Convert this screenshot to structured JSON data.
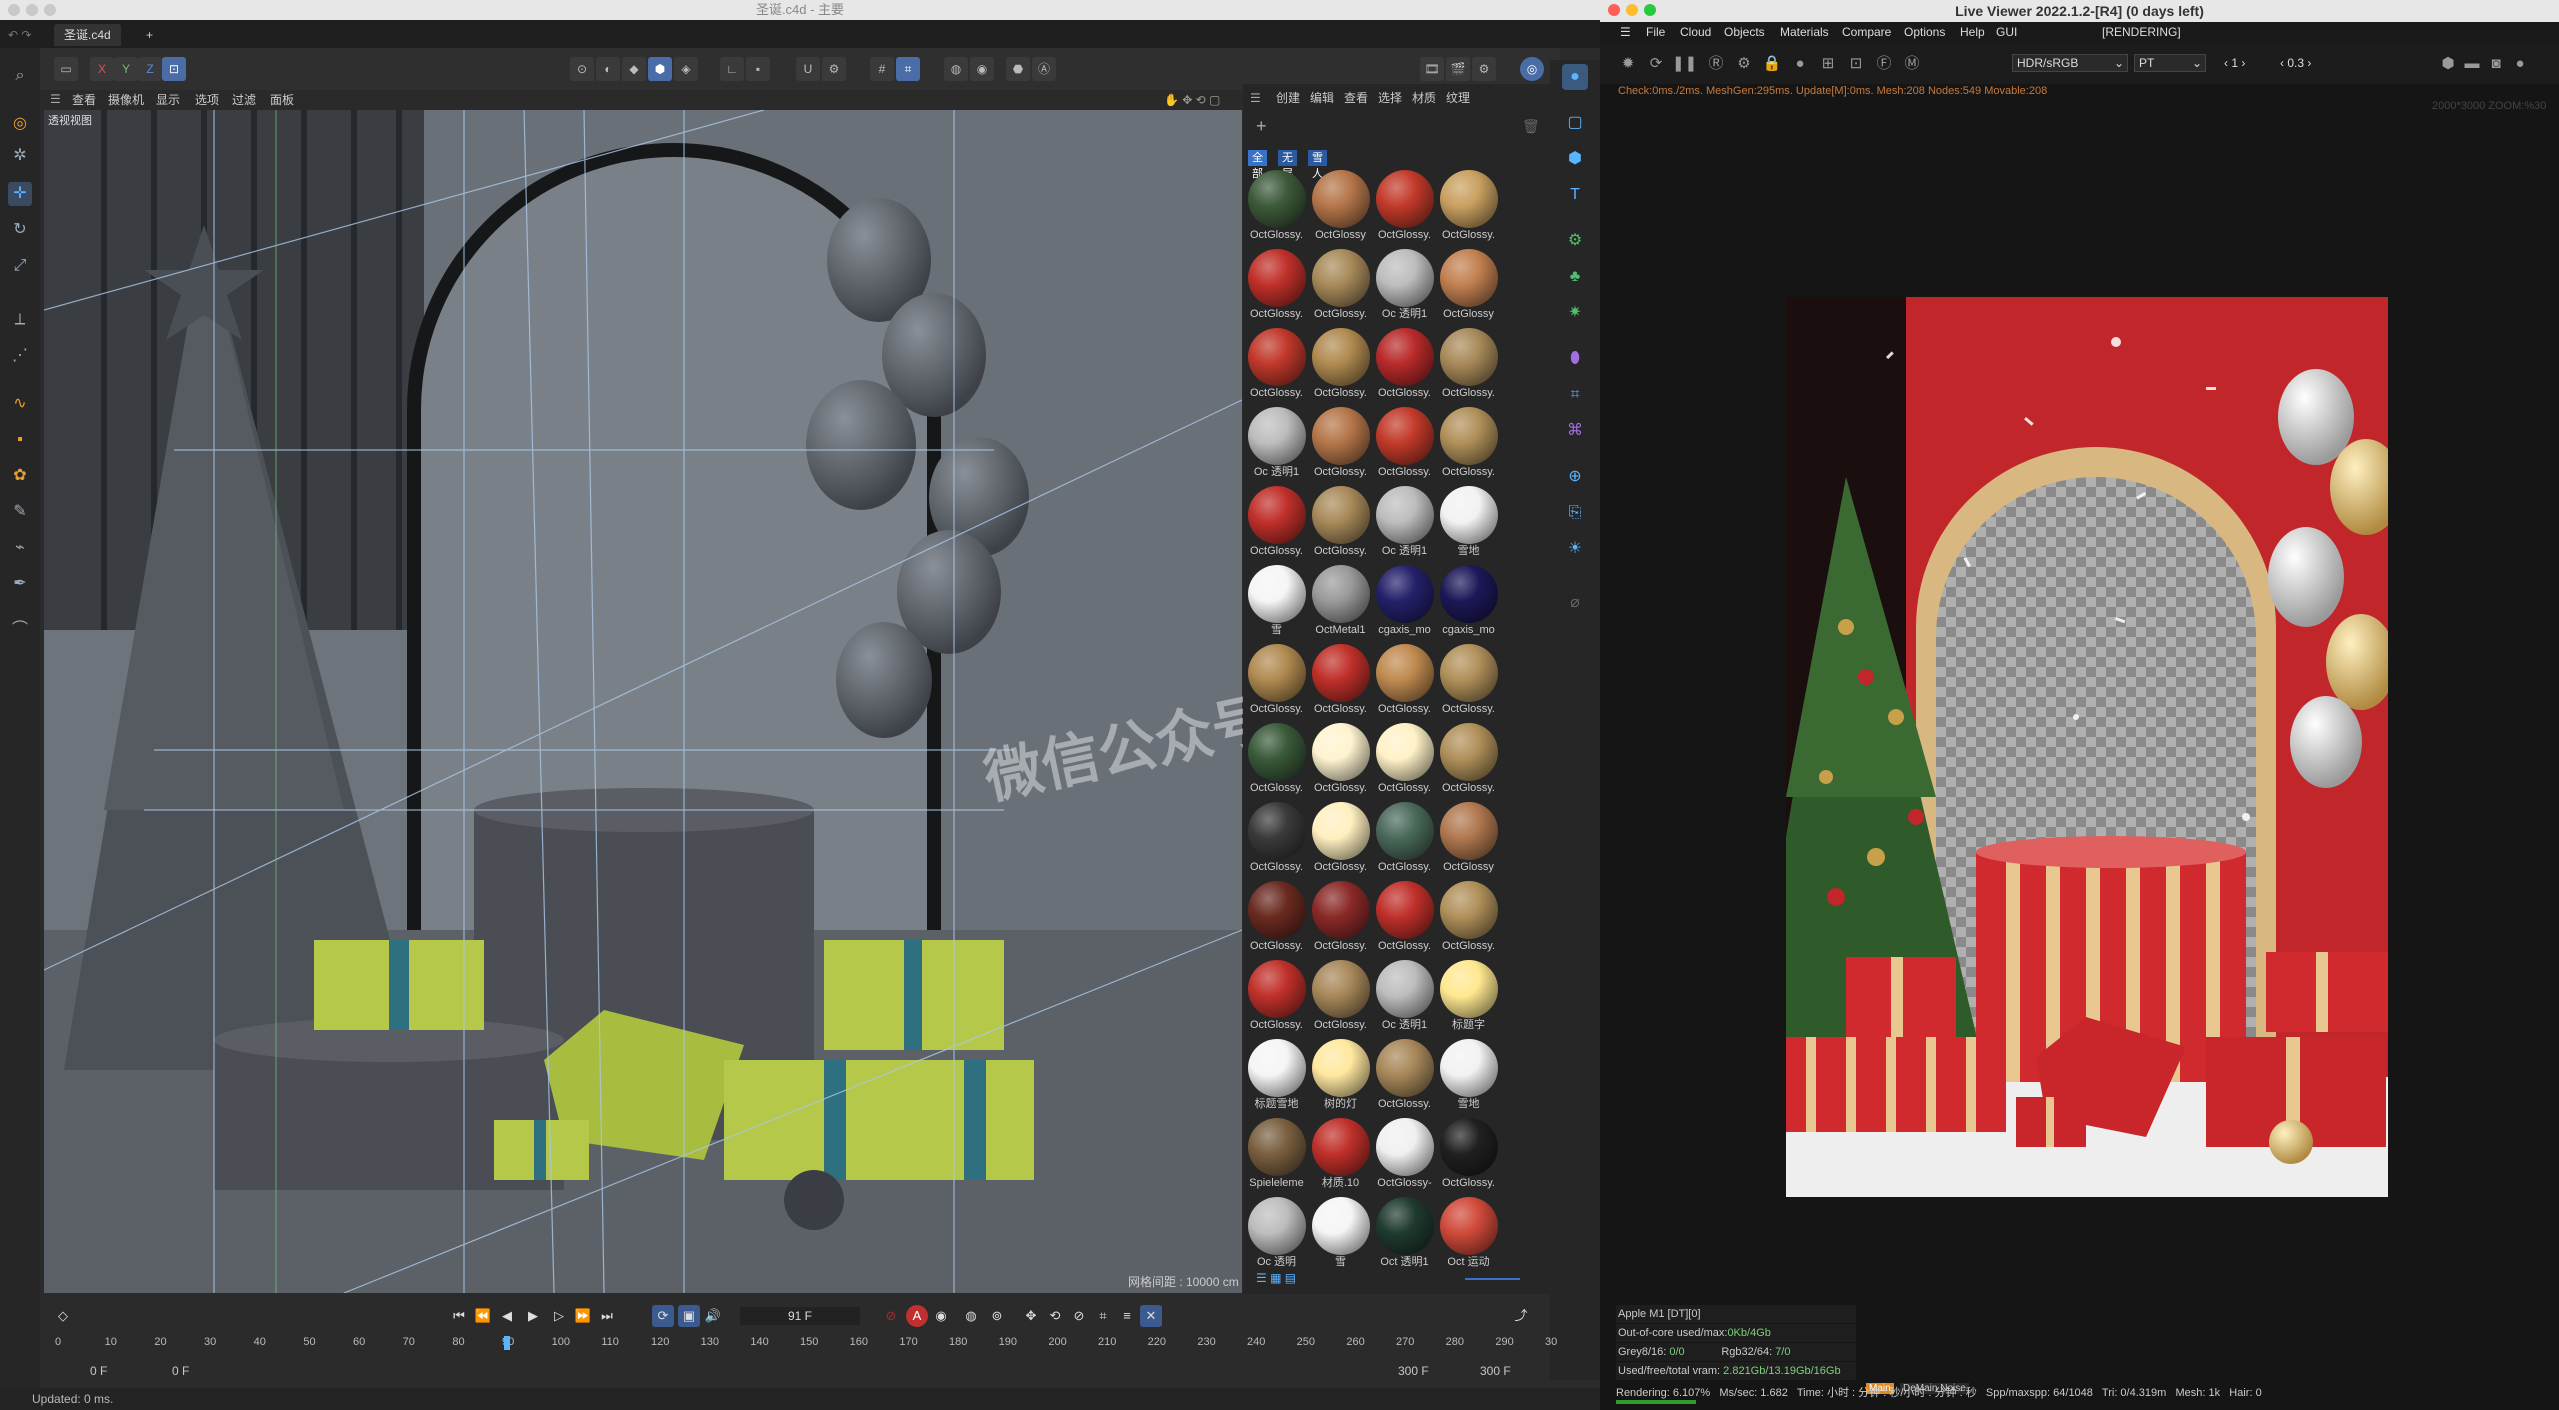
{
  "c4d": {
    "window_title": "圣诞.c4d - 主要",
    "file_tab": "圣诞.c4d",
    "add_tab": "+",
    "axis_labels": [
      "X",
      "Y",
      "Z"
    ],
    "viewport_menu": [
      "查看",
      "摄像机",
      "显示",
      "选项",
      "过滤",
      "面板"
    ],
    "viewport_label": "透视视图",
    "grid_spacing": "网格间距 : 10000 cm",
    "watermark": "微信公众号设计",
    "material_menu": [
      "创建",
      "编辑",
      "查看",
      "选择",
      "材质",
      "纹理"
    ],
    "material_filters": [
      "全部",
      "无层",
      "雪人"
    ],
    "materials": [
      {
        "name": "OctGlossy.",
        "color": "#3d5a3a"
      },
      {
        "name": "OctGlossy",
        "color": "#b5764a"
      },
      {
        "name": "OctGlossy.",
        "color": "#c23a2a"
      },
      {
        "name": "OctGlossy.",
        "color": "#c9a060"
      },
      {
        "name": "OctGlossy.",
        "color": "#c0302a"
      },
      {
        "name": "OctGlossy.",
        "color": "#a88a5a"
      },
      {
        "name": "Oc 透明1",
        "color": "#bdbdbd"
      },
      {
        "name": "OctGlossy",
        "color": "#c28050"
      },
      {
        "name": "OctGlossy.",
        "color": "#c0382a"
      },
      {
        "name": "OctGlossy.",
        "color": "#b08a50"
      },
      {
        "name": "OctGlossy.",
        "color": "#b82a2a"
      },
      {
        "name": "OctGlossy.",
        "color": "#a88a5a"
      },
      {
        "name": "Oc 透明1",
        "color": "#bdbdbd"
      },
      {
        "name": "OctGlossy.",
        "color": "#b5764a"
      },
      {
        "name": "OctGlossy.",
        "color": "#c23a2a"
      },
      {
        "name": "OctGlossy.",
        "color": "#b0905a"
      },
      {
        "name": "OctGlossy.",
        "color": "#c0302a"
      },
      {
        "name": "OctGlossy.",
        "color": "#a88a5a"
      },
      {
        "name": "Oc 透明1",
        "color": "#bdbdbd"
      },
      {
        "name": "雪地",
        "color": "#f2f2f2"
      },
      {
        "name": "雪",
        "color": "#f5f5f5"
      },
      {
        "name": "OctMetal1",
        "color": "#9a9a9a"
      },
      {
        "name": "cgaxis_mo",
        "color": "#24206a"
      },
      {
        "name": "cgaxis_mo",
        "color": "#1c1858"
      },
      {
        "name": "OctGlossy.",
        "color": "#b08a50"
      },
      {
        "name": "OctGlossy.",
        "color": "#c0302a"
      },
      {
        "name": "OctGlossy.",
        "color": "#c08a50"
      },
      {
        "name": "OctGlossy.",
        "color": "#b0905a"
      },
      {
        "name": "OctGlossy.",
        "color": "#3a5a3a"
      },
      {
        "name": "OctGlossy.",
        "color": "#fff4d0"
      },
      {
        "name": "OctGlossy.",
        "color": "#fff2c8"
      },
      {
        "name": "OctGlossy.",
        "color": "#b0905a"
      },
      {
        "name": "OctGlossy.",
        "color": "#3a3a3a"
      },
      {
        "name": "OctGlossy.",
        "color": "#fff0c0"
      },
      {
        "name": "OctGlossy.",
        "color": "#4a6a5a"
      },
      {
        "name": "OctGlossy",
        "color": "#b07850"
      },
      {
        "name": "OctGlossy.",
        "color": "#6a2a20"
      },
      {
        "name": "OctGlossy.",
        "color": "#8a2a28"
      },
      {
        "name": "OctGlossy.",
        "color": "#c0302a"
      },
      {
        "name": "OctGlossy.",
        "color": "#b0905a"
      },
      {
        "name": "OctGlossy.",
        "color": "#c0302a"
      },
      {
        "name": "OctGlossy.",
        "color": "#a8885a"
      },
      {
        "name": "Oc 透明1",
        "color": "#bdbdbd"
      },
      {
        "name": "标题字",
        "color": "#ffe890"
      },
      {
        "name": "标题雪地",
        "color": "#f5f5f5"
      },
      {
        "name": "树的灯",
        "color": "#ffe8a0"
      },
      {
        "name": "OctGlossy.",
        "color": "#a8885a"
      },
      {
        "name": "雪地",
        "color": "#f2f2f2"
      },
      {
        "name": "Spieleleme",
        "color": "#7a6040"
      },
      {
        "name": "材质.10",
        "color": "#c0302a"
      },
      {
        "name": "OctGlossy-",
        "color": "#f0f0f0"
      },
      {
        "name": "OctGlossy.",
        "color": "#202020"
      },
      {
        "name": "Oc 透明",
        "color": "#bdbdbd"
      },
      {
        "name": "雪",
        "color": "#f5f5f5"
      },
      {
        "name": "Oct 透明1",
        "color": "#1f3a2f"
      },
      {
        "name": "Oct 运动",
        "color": "#d04a3a"
      }
    ],
    "timeline": {
      "current_frame": "91 F",
      "start": "0 F",
      "start2": "0 F",
      "end": "300 F",
      "end2": "300 F",
      "ticks": [
        "0",
        "10",
        "20",
        "30",
        "40",
        "50",
        "60",
        "70",
        "80",
        "90",
        "100",
        "110",
        "120",
        "130",
        "140",
        "150",
        "160",
        "170",
        "180",
        "190",
        "200",
        "210",
        "220",
        "230",
        "240",
        "250",
        "260",
        "270",
        "280",
        "290",
        "30"
      ],
      "playhead_frame": 91
    },
    "status": "Updated: 0 ms."
  },
  "lv": {
    "window_title": "Live Viewer 2022.1.2-[R4] (0 days left)",
    "menu": [
      "File",
      "Cloud",
      "Objects",
      "Materials",
      "Compare",
      "Options",
      "Help",
      "GUI"
    ],
    "state": "[RENDERING]",
    "color_space": "HDR/sRGB",
    "kernel": "PT",
    "value1": "1",
    "value2": "0.3",
    "stats_line": "Check:0ms./2ms. MeshGen:295ms. Update[M]:0ms. Mesh:208 Nodes:549 Movable:208",
    "resolution": "2000*3000 ZOOM:%30",
    "info": {
      "device": "Apple M1 [DT][0]",
      "ooc_label": "Out-of-core used/max:",
      "ooc_value": "0Kb/4Gb",
      "grey_label": "Grey8/16:",
      "grey_value": "0/0",
      "rgb_label": "Rgb32/64:",
      "rgb_value": "7/0",
      "vram_label": "Used/free/total vram:",
      "vram_value": "2.821Gb/13.19Gb/16Gb",
      "main_tab": "Main",
      "denoise_tab": "DeMain Noise"
    },
    "status": {
      "rendering": "Rendering: 6.107%",
      "mssec": "Ms/sec: 1.682",
      "time": "Time: 小时 : 分钟 : 秒/小时 : 分钟 : 秒",
      "spp": "Spp/maxspp: 64/1048",
      "tri": "Tri: 0/4.319m",
      "mesh": "Mesh: 1k",
      "hair": "Hair: 0"
    },
    "progress": 0.061
  }
}
